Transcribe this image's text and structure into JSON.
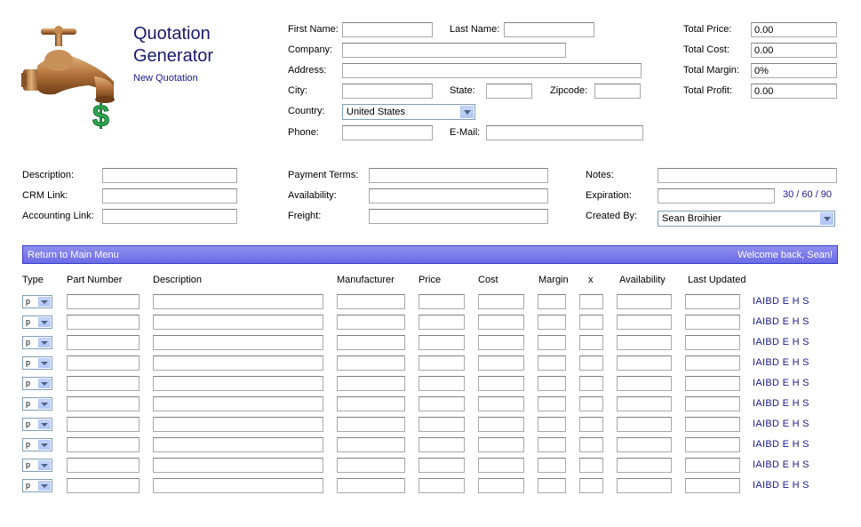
{
  "app": {
    "title_line1": "Quotation",
    "title_line2": "Generator",
    "subtitle": "New Quotation"
  },
  "customer": {
    "first_name_label": "First Name:",
    "last_name_label": "Last Name:",
    "company_label": "Company:",
    "address_label": "Address:",
    "city_label": "City:",
    "state_label": "State:",
    "zipcode_label": "Zipcode:",
    "country_label": "Country:",
    "country_value": "United States",
    "phone_label": "Phone:",
    "email_label": "E-Mail:"
  },
  "totals": {
    "price_label": "Total Price:",
    "price_value": "0.00",
    "cost_label": "Total Cost:",
    "cost_value": "0.00",
    "margin_label": "Total Margin:",
    "margin_value": "0%",
    "profit_label": "Total Profit:",
    "profit_value": "0.00"
  },
  "details": {
    "description_label": "Description:",
    "crm_label": "CRM Link:",
    "accounting_label": "Accounting Link:",
    "payment_label": "Payment Terms:",
    "availability_label": "Availability:",
    "freight_label": "Freight:",
    "notes_label": "Notes:",
    "expiration_label": "Expiration:",
    "expiration_counts": "30 / 60 / 90",
    "created_by_label": "Created By:",
    "created_by_value": "Sean Broihier"
  },
  "nav_bar": {
    "return_label": "Return to Main Menu",
    "welcome": "Welcome back, Sean!"
  },
  "table": {
    "headers": {
      "type": "Type",
      "part_number": "Part Number",
      "description": "Description",
      "manufacturer": "Manufacturer",
      "price": "Price",
      "cost": "Cost",
      "margin": "Margin",
      "x": "x",
      "availability": "Availability",
      "last_updated": "Last Updated"
    },
    "rows": [
      {
        "type": "p",
        "links": "IAIBD E H S"
      },
      {
        "type": "p",
        "links": "IAIBD E H S"
      },
      {
        "type": "p",
        "links": "IAIBD E H S"
      },
      {
        "type": "p",
        "links": "IAIBD E H S"
      },
      {
        "type": "p",
        "links": "IAIBD E H S"
      },
      {
        "type": "p",
        "links": "IAIBD E H S"
      },
      {
        "type": "p",
        "links": "IAIBD E H S"
      },
      {
        "type": "p",
        "links": "IAIBD E H S"
      },
      {
        "type": "p",
        "links": "IAIBD E H S"
      },
      {
        "type": "p",
        "links": "IAIBD E H S"
      }
    ]
  },
  "icons": {
    "logo": "faucet-dollar-icon",
    "dropdown": "chevron-down-icon"
  },
  "colors": {
    "title": "#1a1a6e",
    "link": "#1a1a8e",
    "bar": "#6b6be6"
  }
}
